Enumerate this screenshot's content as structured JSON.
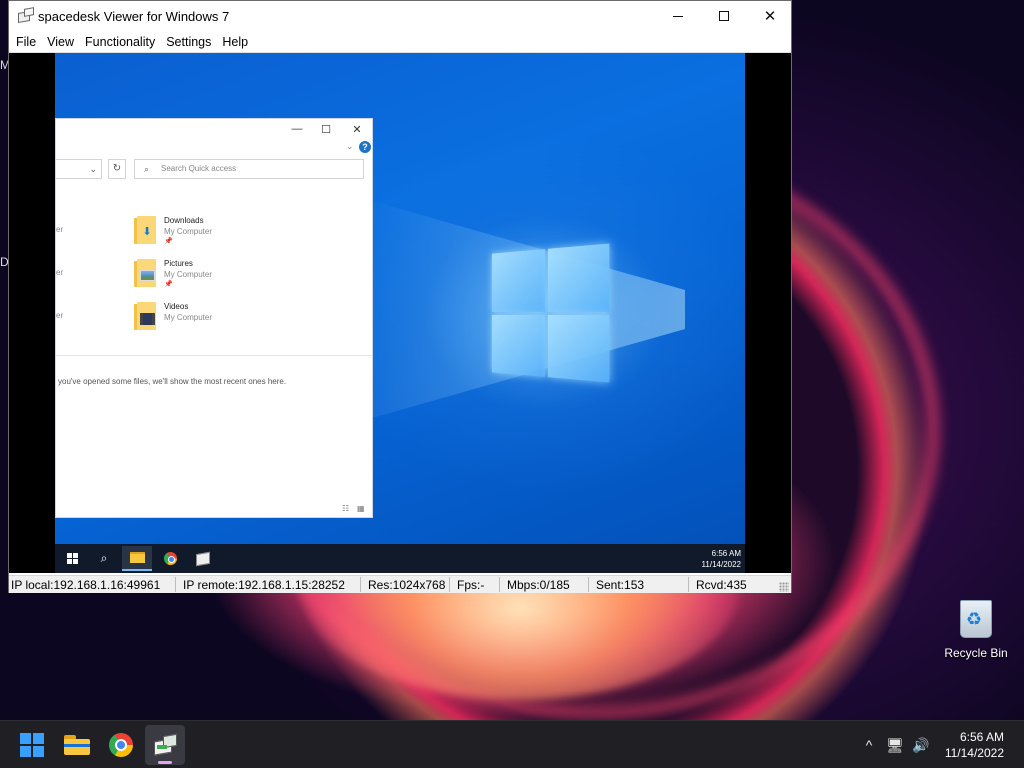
{
  "host": {
    "desktop_icons": [
      {
        "label": "Recycle Bin",
        "icon": "recycle-bin-icon"
      }
    ],
    "taskbar": {
      "apps": [
        {
          "name": "start",
          "icon": "windows-start-icon",
          "active": false
        },
        {
          "name": "file-explorer",
          "icon": "folder-icon",
          "active": false
        },
        {
          "name": "chrome",
          "icon": "chrome-icon",
          "active": false
        },
        {
          "name": "spacedesk",
          "icon": "spacedesk-icon",
          "active": true
        }
      ],
      "tray": {
        "chevron": "^",
        "time": "6:56 AM",
        "date": "11/14/2022"
      }
    }
  },
  "viewer": {
    "title": "spacedesk Viewer for Windows 7",
    "menu": [
      "File",
      "View",
      "Functionality",
      "Settings",
      "Help"
    ],
    "window_controls": {
      "minimize": "minimize",
      "maximize": "maximize",
      "close": "✕"
    },
    "status": {
      "ip_local": "IP local:192.168.1.16:49961",
      "ip_remote": "IP remote:192.168.1.15:28252",
      "res": "Res:1024x768",
      "fps": "Fps:-",
      "mbps": "Mbps:0/185",
      "sent": "Sent:153",
      "rcvd": "Rcvd:435"
    }
  },
  "remote": {
    "explorer": {
      "search_placeholder": "Search Quick access",
      "items": [
        {
          "name": "Downloads",
          "location": "My Computer",
          "kind": "downloads"
        },
        {
          "name": "Pictures",
          "location": "My Computer",
          "kind": "pictures"
        },
        {
          "name": "Videos",
          "location": "My Computer",
          "kind": "videos"
        }
      ],
      "left_fragments": [
        "er",
        "er",
        "er"
      ],
      "recent_message": "you've opened some files, we'll show the most recent ones here."
    },
    "taskbar": {
      "time": "6:56 AM",
      "date": "11/14/2022"
    }
  }
}
